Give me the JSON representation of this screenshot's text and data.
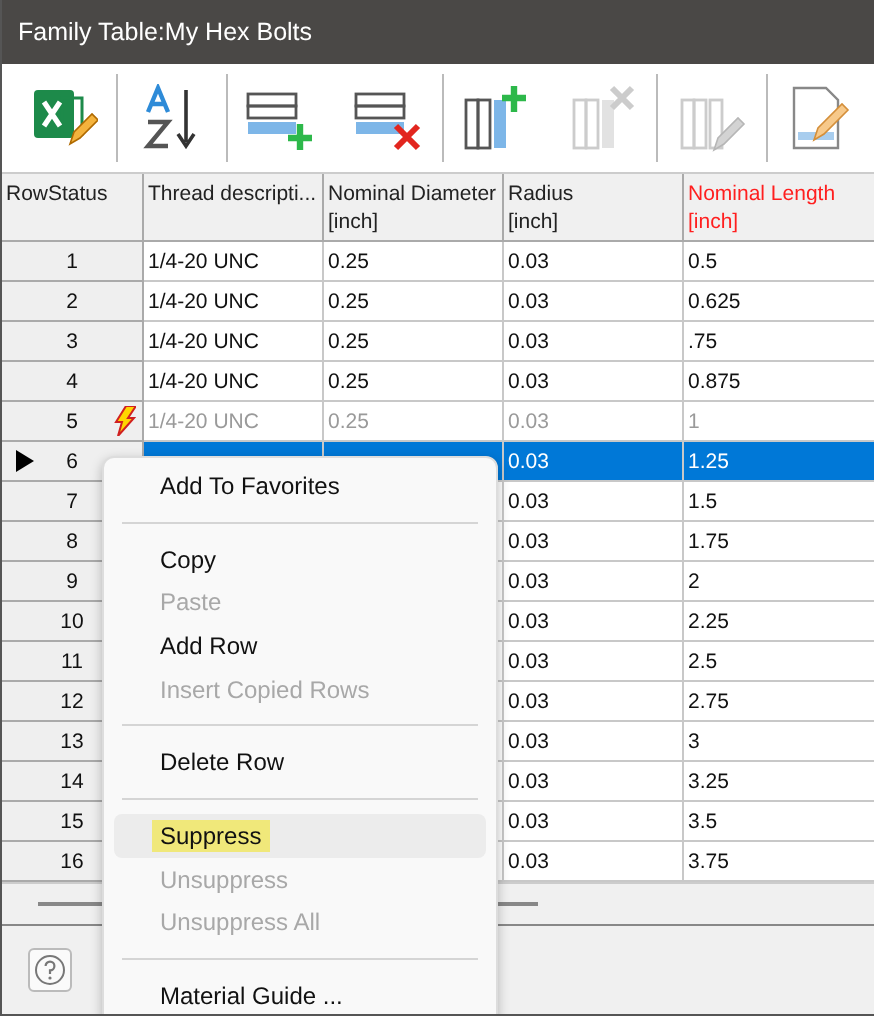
{
  "window": {
    "title": "Family Table:My Hex Bolts"
  },
  "toolbar": [
    {
      "kind": "excel",
      "disabled": false
    },
    {
      "kind": "sort",
      "disabled": false
    },
    {
      "kind": "add-row",
      "disabled": false
    },
    {
      "kind": "delete-row",
      "disabled": false
    },
    {
      "kind": "add-column",
      "disabled": false
    },
    {
      "kind": "delete-column",
      "disabled": true
    },
    {
      "kind": "edit-column",
      "disabled": true
    },
    {
      "kind": "edit-document",
      "disabled": false
    }
  ],
  "table": {
    "columns": [
      {
        "label": "RowStatus",
        "highlighted": false
      },
      {
        "label": "Thread descripti...",
        "highlighted": false
      },
      {
        "label": "Nominal Diameter",
        "unit": "[inch]",
        "highlighted": false
      },
      {
        "label": "Radius",
        "unit": "[inch]",
        "highlighted": false
      },
      {
        "label": "Nominal Length",
        "unit": "[inch]",
        "highlighted": true
      }
    ],
    "rows": [
      {
        "number": "1",
        "thread": "1/4-20 UNC",
        "diameter": "0.25",
        "radius": "0.03",
        "length": "0.5",
        "selected": false,
        "current": false,
        "suppressed": false
      },
      {
        "number": "2",
        "thread": "1/4-20 UNC",
        "diameter": "0.25",
        "radius": "0.03",
        "length": "0.625",
        "selected": false,
        "current": false,
        "suppressed": false
      },
      {
        "number": "3",
        "thread": "1/4-20 UNC",
        "diameter": "0.25",
        "radius": "0.03",
        "length": ".75",
        "selected": false,
        "current": false,
        "suppressed": false
      },
      {
        "number": "4",
        "thread": "1/4-20 UNC",
        "diameter": "0.25",
        "radius": "0.03",
        "length": "0.875",
        "selected": false,
        "current": false,
        "suppressed": false
      },
      {
        "number": "5",
        "thread": "1/4-20 UNC",
        "diameter": "0.25",
        "radius": "0.03",
        "length": "1",
        "selected": false,
        "current": false,
        "suppressed": true
      },
      {
        "number": "6",
        "radius": "0.03",
        "length": "1.25",
        "selected": true,
        "current": true,
        "suppressed": false
      },
      {
        "number": "7",
        "radius": "0.03",
        "length": "1.5",
        "selected": false,
        "current": false,
        "suppressed": false
      },
      {
        "number": "8",
        "radius": "0.03",
        "length": "1.75",
        "selected": false,
        "current": false,
        "suppressed": false
      },
      {
        "number": "9",
        "radius": "0.03",
        "length": "2",
        "selected": false,
        "current": false,
        "suppressed": false
      },
      {
        "number": "10",
        "radius": "0.03",
        "length": "2.25",
        "selected": false,
        "current": false,
        "suppressed": false
      },
      {
        "number": "11",
        "radius": "0.03",
        "length": "2.5",
        "selected": false,
        "current": false,
        "suppressed": false
      },
      {
        "number": "12",
        "radius": "0.03",
        "length": "2.75",
        "selected": false,
        "current": false,
        "suppressed": false
      },
      {
        "number": "13",
        "radius": "0.03",
        "length": "3",
        "selected": false,
        "current": false,
        "suppressed": false
      },
      {
        "number": "14",
        "radius": "0.03",
        "length": "3.25",
        "selected": false,
        "current": false,
        "suppressed": false
      },
      {
        "number": "15",
        "radius": "0.03",
        "length": "3.5",
        "selected": false,
        "current": false,
        "suppressed": false
      },
      {
        "number": "16",
        "radius": "0.03",
        "length": "3.75",
        "selected": false,
        "current": false,
        "suppressed": false
      }
    ]
  },
  "context_menu": [
    {
      "kind": "item",
      "label": "Add To Favorites",
      "disabled": false,
      "hovered": false
    },
    {
      "kind": "separator"
    },
    {
      "kind": "item",
      "label": "Copy",
      "disabled": false,
      "hovered": false
    },
    {
      "kind": "item",
      "label": "Paste",
      "disabled": true,
      "hovered": false
    },
    {
      "kind": "item",
      "label": "Add Row",
      "disabled": false,
      "hovered": false
    },
    {
      "kind": "item",
      "label": "Insert Copied Rows",
      "disabled": true,
      "hovered": false
    },
    {
      "kind": "separator"
    },
    {
      "kind": "item",
      "label": "Delete Row",
      "disabled": false,
      "hovered": false
    },
    {
      "kind": "separator"
    },
    {
      "kind": "item",
      "label": "Suppress",
      "disabled": false,
      "hovered": true
    },
    {
      "kind": "item",
      "label": "Unsuppress",
      "disabled": true,
      "hovered": false
    },
    {
      "kind": "item",
      "label": "Unsuppress All",
      "disabled": true,
      "hovered": false
    },
    {
      "kind": "separator"
    },
    {
      "kind": "item",
      "label": "Material Guide ...",
      "disabled": false,
      "hovered": false
    }
  ]
}
